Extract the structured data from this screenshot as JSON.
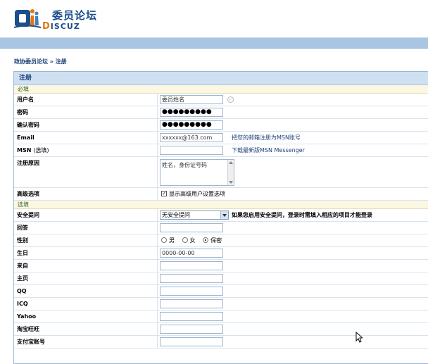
{
  "header": {
    "logo_cn": "委员论坛",
    "logo_en_first": "D",
    "logo_en_rest": "ISCUZ"
  },
  "breadcrumb": {
    "home": "政协委员论坛",
    "separator": "»",
    "current": "注册"
  },
  "panel": {
    "title": "注册",
    "required_section": "必填",
    "optional_section": "选填"
  },
  "required_fields": [
    {
      "label": "用户名",
      "value": "委员姓名"
    },
    {
      "label": "密码",
      "value": "●●●●●●●●●"
    },
    {
      "label": "确认密码",
      "value": "●●●●●●●●●"
    },
    {
      "label": "Email",
      "value": "xxxxxx@163.com",
      "hint": "把您的邮箱注册为MSN账号"
    },
    {
      "label": "MSN",
      "note": "(选填)",
      "value": "",
      "hint": "下载最新版MSN Messenger"
    }
  ],
  "reason": {
    "label": "注册原因",
    "value": "姓名，身份证号码"
  },
  "advanced": {
    "label": "高级选项",
    "checkbox_label": "显示高级用户设置选项",
    "checked": true
  },
  "security": {
    "label": "安全提问",
    "selected": "无安全提问",
    "hint": "如果您启用安全提问，登录时需填入相应的项目才能登录"
  },
  "answer": {
    "label": "回答",
    "value": ""
  },
  "gender": {
    "label": "性别",
    "options": [
      "男",
      "女",
      "保密"
    ],
    "selected": "保密"
  },
  "birthday": {
    "label": "生日",
    "value": "0000-00-00"
  },
  "optional_fields": [
    {
      "label": "来自",
      "value": ""
    },
    {
      "label": "主页",
      "value": ""
    },
    {
      "label": "QQ",
      "value": ""
    },
    {
      "label": "ICQ",
      "value": ""
    },
    {
      "label": "Yahoo",
      "value": ""
    },
    {
      "label": "淘宝旺旺",
      "value": ""
    },
    {
      "label": "支付宝账号",
      "value": ""
    }
  ],
  "icons": {
    "logo": "discuz-logo",
    "validation": "check-circle-icon",
    "cursor": "mouse-pointer-icon"
  },
  "colors": {
    "brand_blue": "#1c4e8a",
    "nav_bar": "#a9c5e2",
    "panel_head": "#cfe0f2",
    "section_bg": "#fbf7e1"
  }
}
